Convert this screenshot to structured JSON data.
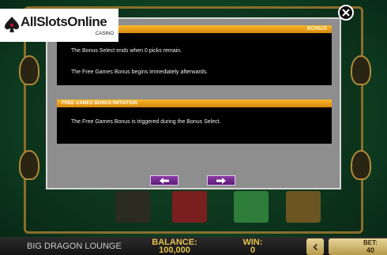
{
  "logo": {
    "brand": "AllSlotsOnline",
    "suffix": ".CASINO"
  },
  "overlay": {
    "panel1": {
      "header_left": "",
      "header_right": "BONUS",
      "line1": "The Bonus Select ends when 0 picks remain.",
      "line2": "The Free Games Bonus begins immediately afterwards."
    },
    "panel2": {
      "header": "FREE GAMES BONUS INITIATION",
      "line1": "The Free Games Bonus is triggered during the Bonus Select."
    },
    "nav": {
      "prev_icon": "arrow-left-icon",
      "next_icon": "arrow-right-icon"
    },
    "close_icon": "close-icon"
  },
  "bottom_bar": {
    "game_title": "BIG DRAGON LOUNGE",
    "balance_label": "BALANCE:",
    "balance_value": "100,000",
    "win_label": "WIN:",
    "win_value": "0",
    "bet_label": "BET:",
    "bet_value": "40",
    "prev_bet_icon": "chevron-left-icon"
  },
  "colors": {
    "header_gradient_top": "#f7b92a",
    "header_gradient_bottom": "#d8860d",
    "nav_button": "#7a2d98",
    "label_gold": "#e2c04a"
  }
}
